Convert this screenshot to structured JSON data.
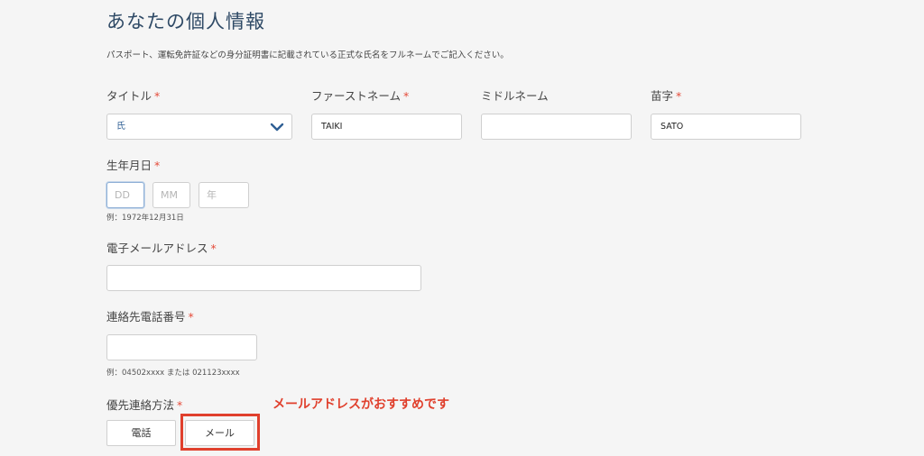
{
  "page": {
    "title": "あなたの個人情報",
    "description": "パスポート、運転免許証などの身分証明書に記載されている正式な氏名をフルネームでご記入ください。"
  },
  "form": {
    "title_field": {
      "label": "タイトル",
      "required": "*",
      "value": "氏"
    },
    "first_name": {
      "label": "ファーストネーム",
      "required": "*",
      "value": "TAIKI"
    },
    "middle_name": {
      "label": "ミドルネーム",
      "value": ""
    },
    "last_name": {
      "label": "苗字",
      "required": "*",
      "value": "SATO"
    },
    "dob": {
      "label": "生年月日",
      "required": "*",
      "day_placeholder": "DD",
      "month_placeholder": "MM",
      "year_placeholder": "年",
      "hint": "例：1972年12月31日"
    },
    "email": {
      "label": "電子メールアドレス",
      "required": "*",
      "value": ""
    },
    "phone": {
      "label": "連絡先電話番号",
      "required": "*",
      "value": "",
      "hint": "例：04502xxxx または 021123xxxx"
    },
    "contact_method": {
      "label": "優先連絡方法",
      "required": "*",
      "options": [
        "電話",
        "メール"
      ]
    }
  },
  "annotation": {
    "text": "メールアドレスがおすすめです",
    "color": "#e0402d"
  },
  "colors": {
    "accent": "#2f5f94",
    "required": "#e54b3a",
    "title": "#2f4a66"
  }
}
